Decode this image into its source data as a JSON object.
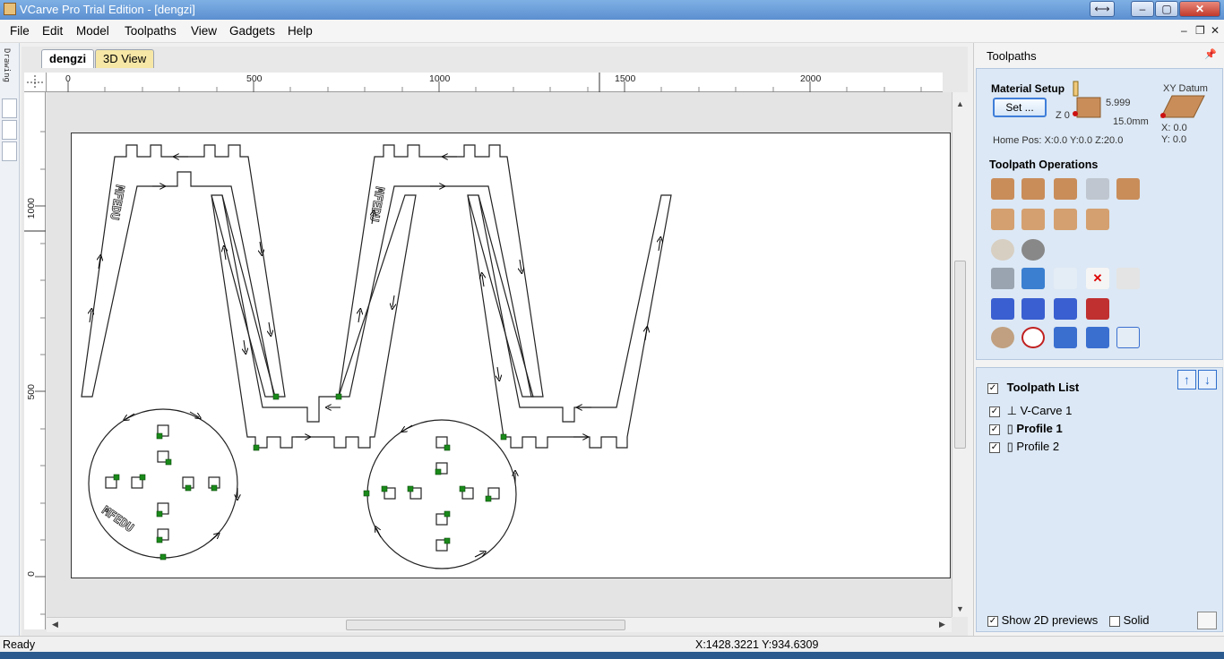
{
  "window": {
    "title": "VCarve Pro Trial Edition - [dengzi]"
  },
  "menu": [
    "File",
    "Edit",
    "Model",
    "Toolpaths",
    "View",
    "Gadgets",
    "Help"
  ],
  "left_strip": {
    "label": "Drawing"
  },
  "tabs": [
    {
      "label": "dengzi",
      "active": true
    },
    {
      "label": "3D View",
      "active": false
    }
  ],
  "rulers": {
    "horizontal": [
      "0",
      "500",
      "1000",
      "1500",
      "2000"
    ],
    "vertical": [
      "1000",
      "500",
      "0"
    ]
  },
  "canvas": {
    "engraved_text": "MFEDU"
  },
  "panel": {
    "title": "Toolpaths",
    "material_setup": {
      "heading": "Material Setup",
      "set_button": "Set ...",
      "z_label": "Z 0",
      "top_value": "5.999",
      "thickness": "15.0mm",
      "home_pos": "Home Pos:  X:0.0 Y:0.0 Z:20.0",
      "xy_datum": "XY Datum",
      "x": "X: 0.0",
      "y": "Y: 0.0"
    },
    "operations_heading": "Toolpath Operations",
    "toolpath_list": {
      "heading": "Toolpath List",
      "items": [
        {
          "label": "V-Carve 1",
          "checked": true,
          "bold": false
        },
        {
          "label": "Profile 1",
          "checked": true,
          "bold": true
        },
        {
          "label": "Profile 2",
          "checked": true,
          "bold": false
        }
      ]
    },
    "show_2d_previews": "Show 2D previews",
    "solid": "Solid"
  },
  "status": {
    "left": "Ready",
    "coords": "X:1428.3221 Y:934.6309"
  },
  "colors": {
    "title_bar": "#6b9bd8",
    "panel_section": "#dce8f5",
    "toolpath_red": "#c00000",
    "node_green": "#1a8a1a"
  }
}
